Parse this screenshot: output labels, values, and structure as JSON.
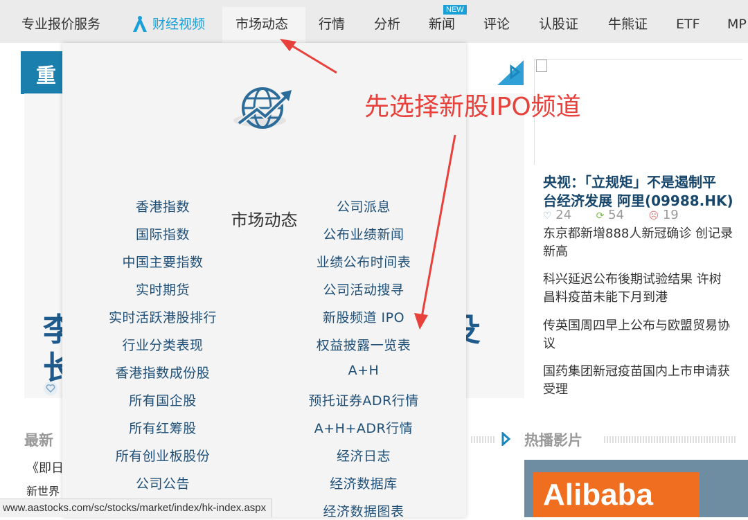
{
  "nav": {
    "items": [
      "专业报价服务",
      "财经视频",
      "市场动态",
      "行情",
      "分析",
      "新闻",
      "评论",
      "认股证",
      "牛熊证",
      "ETF",
      "MP"
    ],
    "new_badge": "NEW",
    "active_index": 2,
    "accent_color": "#1aa0d8"
  },
  "background_page": {
    "banner_text": "重",
    "big_text_left_1": "李",
    "big_text_left_2": "长",
    "big_text_right": "殳",
    "headline": [
      "央视：「立规矩」不是遏制平",
      "台经济发展 阿里(09988.HK)"
    ],
    "stats": {
      "likes": "24",
      "shares": "54",
      "dislikes": "19"
    },
    "news": [
      [
        "东京都新增888人新冠确诊 创记录",
        "新高"
      ],
      [
        "科兴延迟公布後期试验结果 许树",
        "昌料疫苗未能下月到港"
      ],
      [
        "传英国周四早上公布与欧盟贸易协",
        "议"
      ],
      [
        "国药集团新冠疫苗国内上市申请获",
        "受理"
      ]
    ],
    "latest_label": "最新",
    "left_clip_1": "《即日",
    "left_clip_2": "新世界",
    "hot_label": "热播影片",
    "video_text": "Alibaba"
  },
  "dropdown": {
    "title": "市场动态",
    "left_links": [
      "香港指数",
      "国际指数",
      "中国主要指数",
      "实时期货",
      "实时活跃港股排行",
      "行业分类表现",
      "香港指数成份股",
      "所有国企股",
      "所有红筹股",
      "所有创业板股份",
      "公司公告"
    ],
    "right_links": [
      "公司派息",
      "公布业绩新闻",
      "业绩公布时间表",
      "公司活动搜寻",
      "新股频道 IPO",
      "权益披露一览表",
      "A+H",
      "预托证券ADR行情",
      "A+H+ADR行情",
      "经济日志",
      "经济数据库",
      "经济数据图表"
    ]
  },
  "status_url": "www.aastocks.com/sc/stocks/market/index/hk-index.aspx",
  "annotation": {
    "text": "先选择新股IPO频道",
    "color": "#e8403a"
  }
}
